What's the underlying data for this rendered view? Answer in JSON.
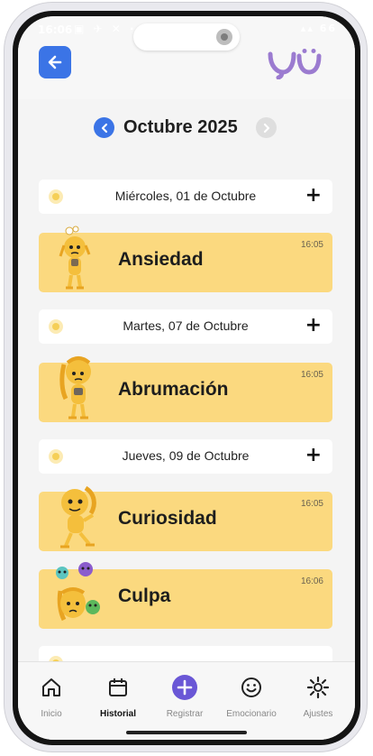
{
  "status_bar": {
    "time": "16:06",
    "battery": "66"
  },
  "header": {
    "back_icon": "arrow-left-icon",
    "logo_text": "yü"
  },
  "month_nav": {
    "title": "Octubre 2025"
  },
  "days": [
    {
      "label": "Miércoles, 01 de Octubre",
      "add": "+",
      "entries": [
        {
          "emotion": "Ansiedad",
          "time": "16:05"
        }
      ]
    },
    {
      "label": "Martes, 07 de Octubre",
      "add": "+",
      "entries": [
        {
          "emotion": "Abrumación",
          "time": "16:05"
        }
      ]
    },
    {
      "label": "Jueves, 09 de Octubre",
      "add": "+",
      "entries": [
        {
          "emotion": "Curiosidad",
          "time": "16:05"
        },
        {
          "emotion": "Culpa",
          "time": "16:06"
        }
      ]
    }
  ],
  "bottom_nav": [
    {
      "label": "Inicio",
      "icon": "home-icon"
    },
    {
      "label": "Historial",
      "icon": "calendar-icon",
      "active": true
    },
    {
      "label": "Registrar",
      "icon": "plus-circle-icon"
    },
    {
      "label": "Emocionario",
      "icon": "smile-icon"
    },
    {
      "label": "Ajustes",
      "icon": "gear-icon"
    }
  ],
  "colors": {
    "accent": "#3b74e6",
    "card": "#fbd97f",
    "logo": "#9b7bd0",
    "register": "#6a57d6"
  }
}
